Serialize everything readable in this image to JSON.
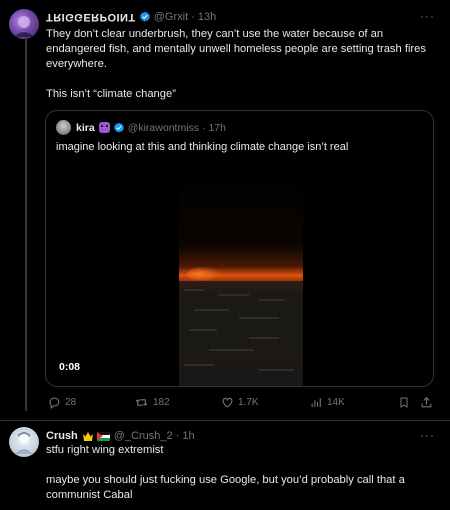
{
  "main_tweet": {
    "display_name": "TRIGGERPOINT",
    "handle": "@Grxit",
    "time": "· 13h",
    "more": "···",
    "paragraph_1": "They don’t clear underbrush, they can’t use the water because of an endangered fish, and mentally unwell homeless people are setting trash fires everywhere.",
    "paragraph_2": "This isn’t “climate change”"
  },
  "quoted_tweet": {
    "display_name": "kira",
    "handle": "@kirawontmiss",
    "time": "· 17h",
    "text": "imagine looking at this and thinking climate change isn’t real",
    "video_duration": "0:08"
  },
  "actions": {
    "replies": "28",
    "retweets": "182",
    "likes": "1.7K",
    "views": "14K"
  },
  "reply_tweet": {
    "display_name": "Crush",
    "handle": "@_Crush_2",
    "time": "· 1h",
    "more": "···",
    "line_1": "stfu right wing extremist",
    "line_2": "maybe you should just fucking use Google, but you’d probably call that a communist Cabal"
  },
  "colors": {
    "background": "#000000",
    "text": "#e7e9ea",
    "muted": "#71767b",
    "verified": "#1d9bf0",
    "border": "#2f3336"
  }
}
